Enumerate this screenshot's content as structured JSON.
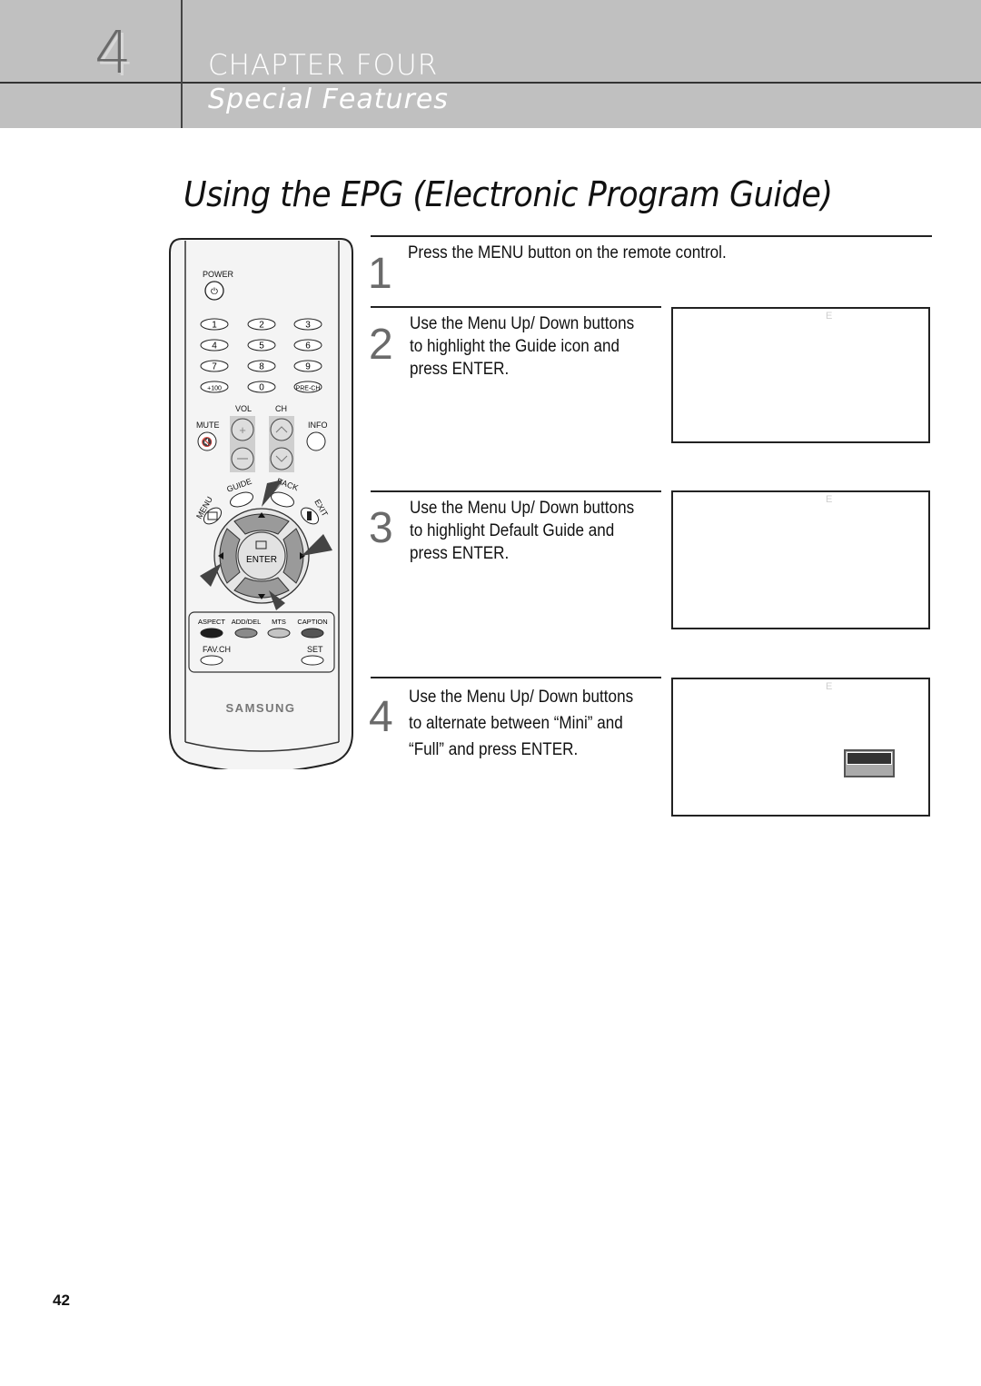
{
  "header": {
    "chapter_number": "4",
    "chapter_title": "CHAPTER FOUR",
    "chapter_subtitle": "Special Features"
  },
  "page_title": "Using the EPG (Electronic Program Guide)",
  "steps": [
    {
      "number": "1",
      "text_lines": [
        "Press the MENU button on the remote control."
      ]
    },
    {
      "number": "2",
      "text_lines": [
        "Use the Menu Up/ Down buttons",
        "to highlight the Guide icon and",
        "press ENTER."
      ],
      "screen_glyph": "E"
    },
    {
      "number": "3",
      "text_lines": [
        "Use the Menu Up/ Down buttons",
        "to highlight Default Guide and",
        "press ENTER."
      ],
      "screen_glyph": "E"
    },
    {
      "number": "4",
      "text_lines": [
        "Use the Menu Up/ Down buttons",
        "to alternate between “Mini” and",
        "“Full” and press ENTER."
      ],
      "screen_glyph": "E"
    }
  ],
  "remote": {
    "power_label": "POWER",
    "number_keys": [
      "1",
      "2",
      "3",
      "4",
      "5",
      "6",
      "7",
      "8",
      "9",
      "+100",
      "0",
      "PRE-CH"
    ],
    "vol_label": "VOL",
    "ch_label": "CH",
    "mute_label": "MUTE",
    "info_label": "INFO",
    "guide_label": "GUIDE",
    "back_label": "BACK",
    "menu_label": "MENU",
    "exit_label": "EXIT",
    "enter_label": "ENTER",
    "color_keys": [
      {
        "label": "ASPECT",
        "color": "#1e1e1e"
      },
      {
        "label": "ADD/DEL",
        "color": "#8a8a8a"
      },
      {
        "label": "MTS",
        "color": "#c4c4c4"
      },
      {
        "label": "CAPTION",
        "color": "#555555"
      }
    ],
    "favch_label": "FAV.CH",
    "set_label": "SET",
    "brand": "SAMSUNG"
  },
  "page_number": "42"
}
